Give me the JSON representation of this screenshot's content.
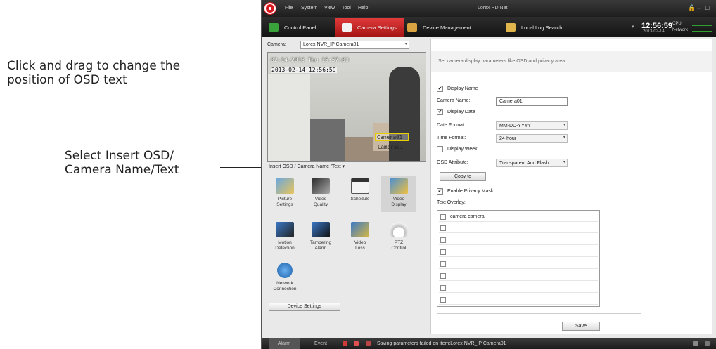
{
  "callouts": {
    "osd_drag": "Click and drag to change the\nposition of OSD text",
    "insert_osd": "Select Insert OSD/\nCamera Name/Text"
  },
  "menubar": {
    "items": [
      "File",
      "System",
      "View",
      "Tool",
      "Help"
    ],
    "title": "Lorex HD Net"
  },
  "tabs": [
    {
      "label": "Control Panel",
      "icon": "control-panel-icon",
      "color": "#3aa23a"
    },
    {
      "label": "Camera Settings",
      "icon": "camera-settings-icon",
      "color": "#f2f2f2"
    },
    {
      "label": "Device Management",
      "icon": "device-management-icon",
      "color": "#d9a441"
    },
    {
      "label": "Local Log Search",
      "icon": "log-search-icon",
      "color": "#e1b54c"
    }
  ],
  "clock": {
    "time": "12:56:59",
    "date": "2013-02-14"
  },
  "meters": {
    "cpu_label": "CPU",
    "network_label": "Network"
  },
  "camera": {
    "label": "Camera:",
    "selected": "Lorex NVR_IP Camera01"
  },
  "preview": {
    "osd_date": "02-14-2013 Thu 15:57:00",
    "osd_date_drag": "2013-02-14 12:56:59",
    "osd_name": "Camera01",
    "osd_name2": "Camera01"
  },
  "insert_osd": "Insert OSD / Camera Name /Text",
  "tools": [
    {
      "label": "Picture\nSettings",
      "icon": "picture-settings-icon"
    },
    {
      "label": "Video\nQuality",
      "icon": "video-quality-icon"
    },
    {
      "label": "Schedule",
      "icon": "schedule-icon"
    },
    {
      "label": "Video\nDisplay",
      "icon": "video-display-icon"
    },
    {
      "label": "Motion\nDetection",
      "icon": "motion-detection-icon"
    },
    {
      "label": "Tampering\nAlarm",
      "icon": "tampering-alarm-icon"
    },
    {
      "label": "Video\nLoss",
      "icon": "video-loss-icon"
    },
    {
      "label": "PTZ\nControl",
      "icon": "ptz-control-icon"
    },
    {
      "label": "Network\nConnection",
      "icon": "network-connection-icon"
    }
  ],
  "device_settings": "Device Settings",
  "settings": {
    "description": "Set camera display parameters like OSD and privacy area.",
    "display_name": "Display Name",
    "camera_name_label": "Camera Name:",
    "camera_name_value": "Camera01",
    "display_date": "Display Date",
    "date_format_label": "Date Format:",
    "date_format_value": "MM-DD-YYYY",
    "time_format_label": "Time Format:",
    "time_format_value": "24-hour",
    "display_week": "Display Week",
    "osd_attribute_label": "OSD Attribute:",
    "osd_attribute_value": "Transparent And Flash",
    "copy_to": "Copy to",
    "enable_privacy_mask": "Enable Privacy Mask",
    "text_overlay_label": "Text Overlay:",
    "overlay_rows": [
      "camera camera",
      "",
      "",
      "",
      "",
      "",
      "",
      ""
    ],
    "save": "Save"
  },
  "statusbar": {
    "tabs": [
      "Alarm",
      "Event"
    ],
    "message": "Saving parameters failed on item:Lorex NVR_IP Camera01"
  }
}
